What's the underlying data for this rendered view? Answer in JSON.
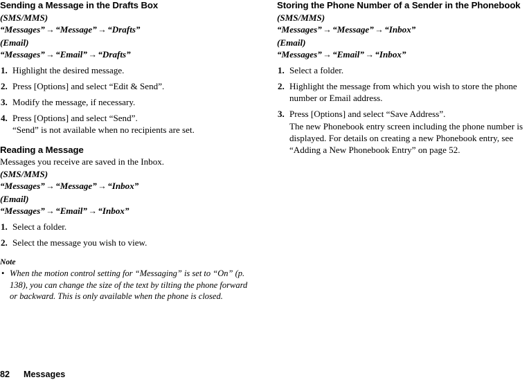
{
  "page": {
    "number": "82",
    "chapter": "Messages"
  },
  "left_column": {
    "section1": {
      "heading": "Sending a Message in the Drafts Box",
      "label_sms": "(SMS/MMS)",
      "path_sms": {
        "part1": "“Messages”",
        "arrow1": "→",
        "part2": "“Message”",
        "arrow2": "→",
        "part3": "“Drafts”"
      },
      "label_email": "(Email)",
      "path_email": {
        "part1": "“Messages”",
        "arrow1": "→",
        "part2": "“Email”",
        "arrow2": "→",
        "part3": "“Drafts”"
      },
      "steps": [
        {
          "num": "1.",
          "text": "Highlight the desired message.",
          "sub": ""
        },
        {
          "num": "2.",
          "text": "Press [Options] and select “Edit & Send”.",
          "sub": ""
        },
        {
          "num": "3.",
          "text": "Modify the message, if necessary.",
          "sub": ""
        },
        {
          "num": "4.",
          "text": "Press [Options] and select “Send”.",
          "sub": "“Send” is not available when no recipients are set."
        }
      ]
    },
    "section2": {
      "heading": "Reading a Message",
      "intro": "Messages you receive are saved in the Inbox.",
      "label_sms": "(SMS/MMS)",
      "path_sms": {
        "part1": "“Messages”",
        "arrow1": "→",
        "part2": "“Message”",
        "arrow2": "→",
        "part3": "“Inbox”"
      },
      "label_email": "(Email)",
      "path_email": {
        "part1": "“Messages”",
        "arrow1": "→",
        "part2": "“Email”",
        "arrow2": "→",
        "part3": "“Inbox”"
      },
      "steps": [
        {
          "num": "1.",
          "text": "Select a folder.",
          "sub": ""
        },
        {
          "num": "2.",
          "text": "Select the message you wish to view.",
          "sub": ""
        }
      ],
      "note": {
        "label": "Note",
        "bullet": "•",
        "text": "When the motion control setting for “Messaging” is set to “On” (p. 138), you can change the size of the text by tilting the phone forward or backward. This is only available when the phone is closed."
      }
    }
  },
  "right_column": {
    "section1": {
      "heading": "Storing the Phone Number of a Sender in the Phonebook",
      "label_sms": "(SMS/MMS)",
      "path_sms": {
        "part1": "“Messages”",
        "arrow1": "→",
        "part2": "“Message”",
        "arrow2": "→",
        "part3": "“Inbox”"
      },
      "label_email": "(Email)",
      "path_email": {
        "part1": "“Messages”",
        "arrow1": "→",
        "part2": "“Email”",
        "arrow2": "→",
        "part3": "“Inbox”"
      },
      "steps": [
        {
          "num": "1.",
          "text": "Select a folder.",
          "sub": ""
        },
        {
          "num": "2.",
          "text": "Highlight the message from which you wish to store the phone number or Email address.",
          "sub": ""
        },
        {
          "num": "3.",
          "text": "Press [Options] and select “Save Address”.",
          "sub": "The new Phonebook entry screen including the phone number is displayed. For details on creating a new Phonebook entry, see “Adding a New Phonebook Entry” on page 52."
        }
      ]
    }
  }
}
